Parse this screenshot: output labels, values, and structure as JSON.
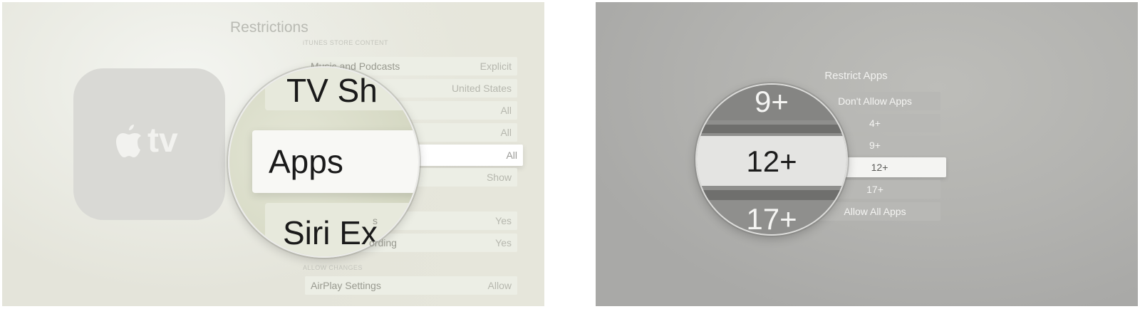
{
  "left_screen": {
    "title": "Restrictions",
    "section_top": "iTUNES STORE CONTENT",
    "section_allow": "ALLOW CHANGES",
    "logo_text": "tv",
    "rows": [
      {
        "label": "Music and Podcasts",
        "value": "Explicit"
      },
      {
        "label": "",
        "value": "United States"
      },
      {
        "label": "",
        "value": "All"
      },
      {
        "label": "",
        "value": "All"
      },
      {
        "label": "",
        "value": "All"
      },
      {
        "label": "",
        "value": "Show"
      },
      {
        "label": "",
        "value": "Yes"
      },
      {
        "label": "",
        "value": "Yes"
      },
      {
        "label": "AirPlay Settings",
        "value": "Allow"
      }
    ],
    "magnifier": {
      "top_text": "TV Sh",
      "focus_text": "Apps",
      "bottom_text": "Siri Ex",
      "row_fragment_1": "s",
      "row_fragment_2": "ording"
    }
  },
  "right_screen": {
    "title": "Restrict Apps",
    "options": [
      "Don't Allow Apps",
      "4+",
      "9+",
      "12+",
      "17+",
      "Allow All Apps"
    ],
    "selected_option": "12+",
    "magnifier": {
      "above": "9+",
      "focus": "12+",
      "below": "17+"
    }
  },
  "colors": {
    "selected_row": "#ffffff",
    "right_background": "#b3b3b0"
  }
}
